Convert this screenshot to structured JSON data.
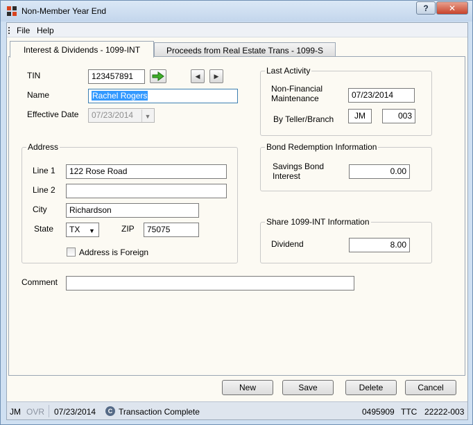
{
  "window": {
    "title": "Non-Member Year End"
  },
  "menu": {
    "file": "File",
    "help": "Help"
  },
  "tabs": [
    {
      "label": "Interest & Dividends - 1099-INT",
      "active": true
    },
    {
      "label": "Proceeds from Real Estate Trans - 1099-S",
      "active": false
    }
  ],
  "main": {
    "tin_label": "TIN",
    "tin_value": "123457891",
    "name_label": "Name",
    "name_value": "Rachel Rogers",
    "effective_date_label": "Effective Date",
    "effective_date_value": "07/23/2014"
  },
  "address": {
    "title": "Address",
    "line1_label": "Line 1",
    "line1_value": "122 Rose Road",
    "line2_label": "Line 2",
    "line2_value": "",
    "city_label": "City",
    "city_value": "Richardson",
    "state_label": "State",
    "state_value": "TX",
    "zip_label": "ZIP",
    "zip_value": "75075",
    "foreign_label": "Address is Foreign"
  },
  "last_activity": {
    "title": "Last Activity",
    "nonfin_label_1": "Non-Financial",
    "nonfin_label_2": "Maintenance",
    "nonfin_value": "07/23/2014",
    "teller_label": "By Teller/Branch",
    "teller_value": "JM",
    "branch_value": "003"
  },
  "bond": {
    "title": "Bond Redemption Information",
    "label_1": "Savings Bond",
    "label_2": "Interest",
    "value": "0.00"
  },
  "share": {
    "title": "Share 1099-INT Information",
    "dividend_label": "Dividend",
    "dividend_value": "8.00"
  },
  "comment": {
    "label": "Comment",
    "value": ""
  },
  "buttons": {
    "new": "New",
    "save": "Save",
    "delete": "Delete",
    "cancel": "Cancel"
  },
  "status": {
    "user": "JM",
    "ovr": "OVR",
    "date": "07/23/2014",
    "c_glyph": "C",
    "message": "Transaction Complete",
    "code1": "0495909",
    "code2": "TTC",
    "code3": "22222-003"
  },
  "title_buttons": {
    "help": "?",
    "close": "✕"
  },
  "icons": {
    "go": "green-arrow-icon",
    "prev": "left-arrow-icon",
    "next": "right-arrow-icon",
    "dropdown": "chevron-down-icon"
  }
}
